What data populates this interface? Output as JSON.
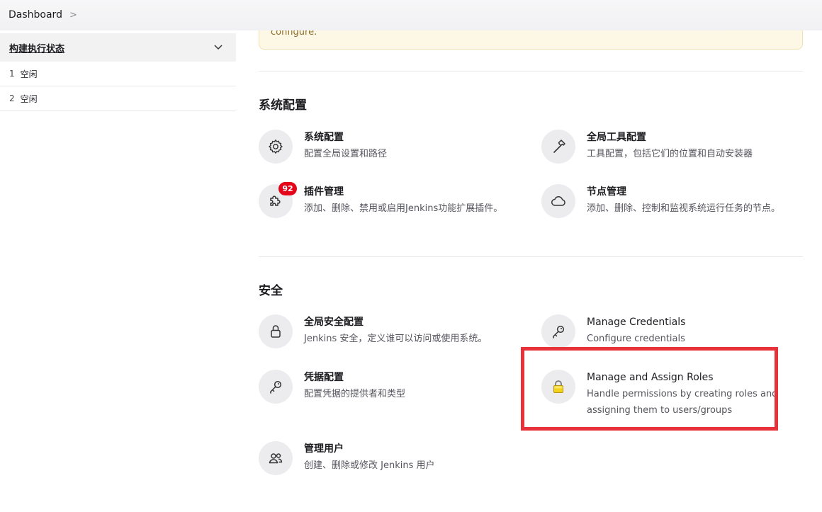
{
  "breadcrumb": {
    "home": "Dashboard",
    "separator": ">"
  },
  "executors": {
    "title": "构建执行状态",
    "rows": [
      {
        "num": "1",
        "status": "空闲"
      },
      {
        "num": "2",
        "status": "空闲"
      }
    ]
  },
  "alert": {
    "text": "configure."
  },
  "sections": {
    "system": {
      "title": "系统配置",
      "items": [
        {
          "title": "系统配置",
          "desc": "配置全局设置和路径",
          "icon": "gear-icon"
        },
        {
          "title": "全局工具配置",
          "desc": "工具配置，包括它们的位置和自动安装器",
          "icon": "hammer-icon"
        },
        {
          "title": "插件管理",
          "desc": "添加、删除、禁用或启用Jenkins功能扩展插件。",
          "icon": "puzzle-icon",
          "badge": "92"
        },
        {
          "title": "节点管理",
          "desc": "添加、删除、控制和监视系统运行任务的节点。",
          "icon": "cloud-icon"
        }
      ]
    },
    "security": {
      "title": "安全",
      "items": [
        {
          "title": "全局安全配置",
          "desc": "Jenkins 安全，定义谁可以访问或使用系统。",
          "icon": "lock-icon"
        },
        {
          "title": "Manage Credentials",
          "desc": "Configure credentials",
          "icon": "key-icon"
        },
        {
          "title": "凭据配置",
          "desc": "配置凭据的提供者和类型",
          "icon": "key-icon"
        },
        {
          "title": "Manage and Assign Roles",
          "desc_line1": "Handle permissions by creating roles and",
          "desc_line2": "assigning them to users/groups",
          "icon": "padlock-yellow-icon"
        },
        {
          "title": "管理用户",
          "desc": "创建、删除或修改 Jenkins 用户",
          "icon": "users-icon"
        }
      ]
    }
  },
  "colors": {
    "highlight": "#e8323a",
    "badge": "#e4051b",
    "alert_bg": "#fdf8e6"
  }
}
